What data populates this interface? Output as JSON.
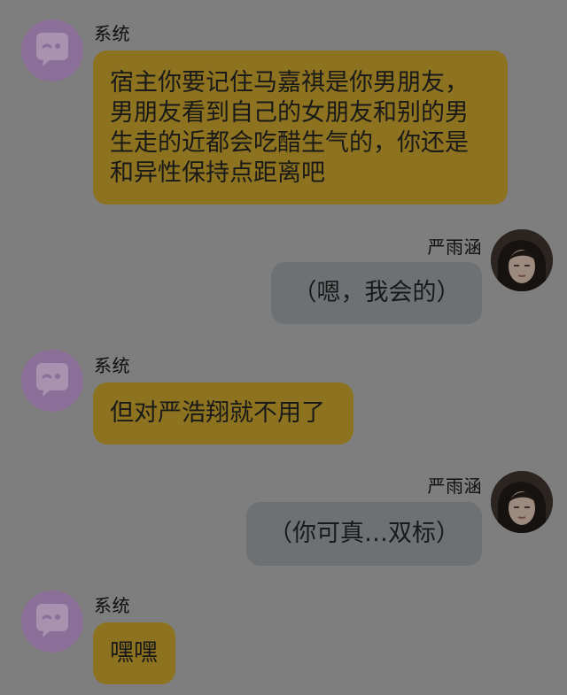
{
  "conversation": {
    "messages": [
      {
        "sender": "系统",
        "lines": [
          "宿主你要记住马嘉祺是你男朋友，",
          "男朋友看到自己的女朋友和别的男",
          "生走的近都会吃醋生气的，你还是",
          "和异性保持点距离吧"
        ]
      },
      {
        "sender": "严雨涵",
        "text": "（嗯，我会的）"
      },
      {
        "sender": "系统",
        "text": "但对严浩翔就不用了"
      },
      {
        "sender": "严雨涵",
        "text": "（你可真…双标）"
      },
      {
        "sender": "系统",
        "text": "嘿嘿"
      }
    ]
  },
  "colors": {
    "background": "#7e7e7e",
    "system_bubble": "#8d7320",
    "user_bubble": "#6d7174",
    "system_avatar": "#8b6f98"
  },
  "icons": {
    "system_avatar": "chat-bubble-wink-icon",
    "user_avatar": "user-photo"
  }
}
